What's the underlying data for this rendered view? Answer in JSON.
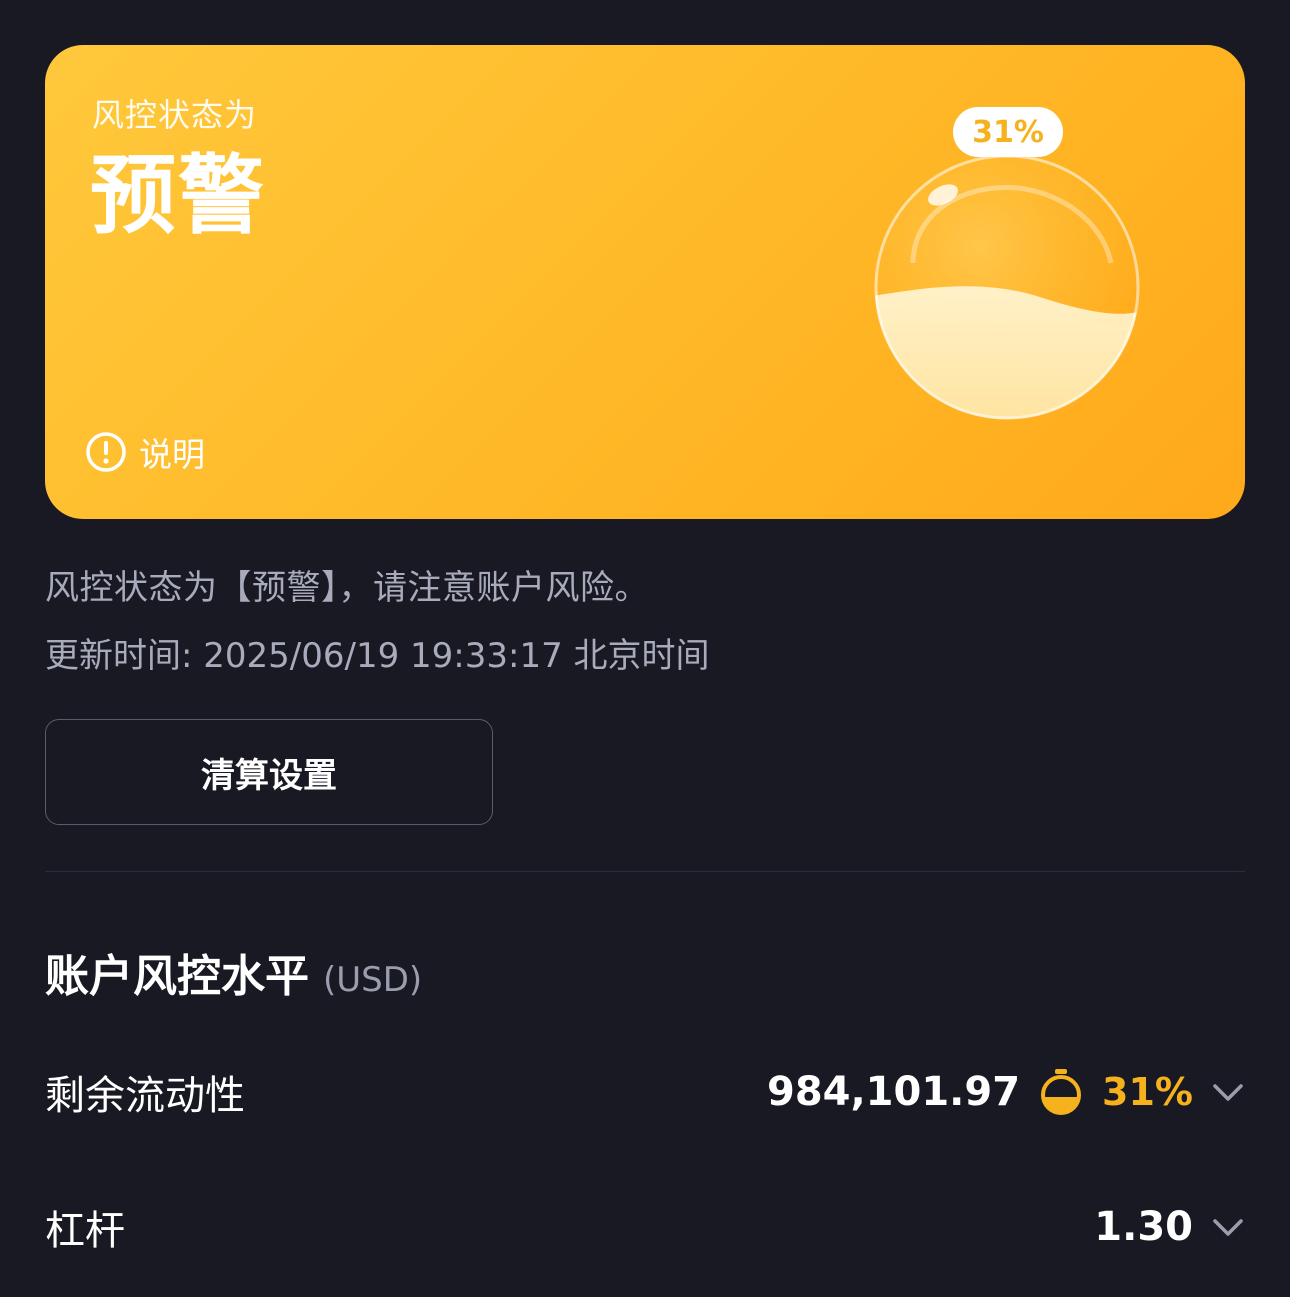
{
  "card": {
    "subtitle": "风控状态为",
    "status": "预警",
    "explain_label": "说明",
    "orb_percent_label": "31%",
    "orb_fill_fraction": 0.31,
    "colors": {
      "gradient_start": "#ffc83c",
      "gradient_end": "#ffa91a",
      "badge_text": "#f5b21c"
    }
  },
  "notice": "风控状态为【预警】，请注意账户风险。",
  "update_time": "更新时间: 2025/06/19 19:33:17 北京时间",
  "settle_button_label": "清算设置",
  "section": {
    "title": "账户风控水平",
    "unit": "(USD)"
  },
  "rows": [
    {
      "label": "剩余流动性",
      "value": "984,101.97",
      "percent": "31%",
      "icon": "timer-icon",
      "has_chevron": true
    },
    {
      "label": "杠杆",
      "value": "1.30",
      "has_chevron": true
    }
  ],
  "icons": {
    "explain": "exclamation-circle-icon",
    "expand": "chevron-down-icon"
  }
}
